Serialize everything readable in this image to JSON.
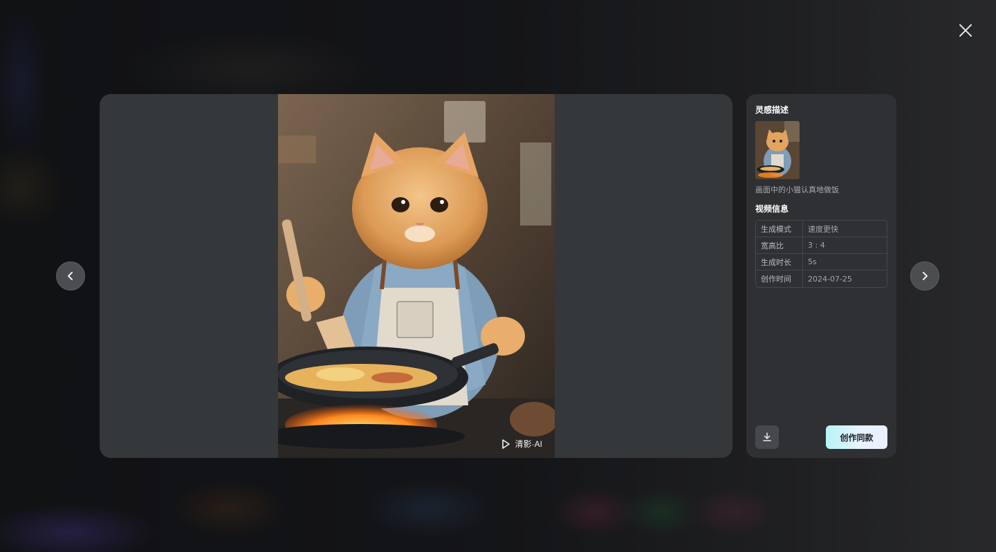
{
  "modal": {
    "close_icon": "close-icon",
    "prev_icon": "chevron-left-icon",
    "next_icon": "chevron-right-icon"
  },
  "media": {
    "watermark": "清影·AI",
    "watermark_icon": "play-logo-icon"
  },
  "panel": {
    "inspiration_title": "灵感描述",
    "prompt": "画面中的小猫认真地做饭",
    "video_info_title": "视频信息",
    "info_rows": [
      {
        "label": "生成模式",
        "value": "速度更快"
      },
      {
        "label": "宽高比",
        "value": "3 : 4"
      },
      {
        "label": "生成时长",
        "value": "5s"
      },
      {
        "label": "创作时间",
        "value": "2024-07-25"
      }
    ],
    "download_icon": "download-icon",
    "create_same_label": "创作同款"
  },
  "colors": {
    "stage_bg": "#35383a",
    "panel_bg": "#2e3033",
    "accent_gradient_start": "#b9f3f5",
    "accent_gradient_end": "#eaf0ff"
  }
}
